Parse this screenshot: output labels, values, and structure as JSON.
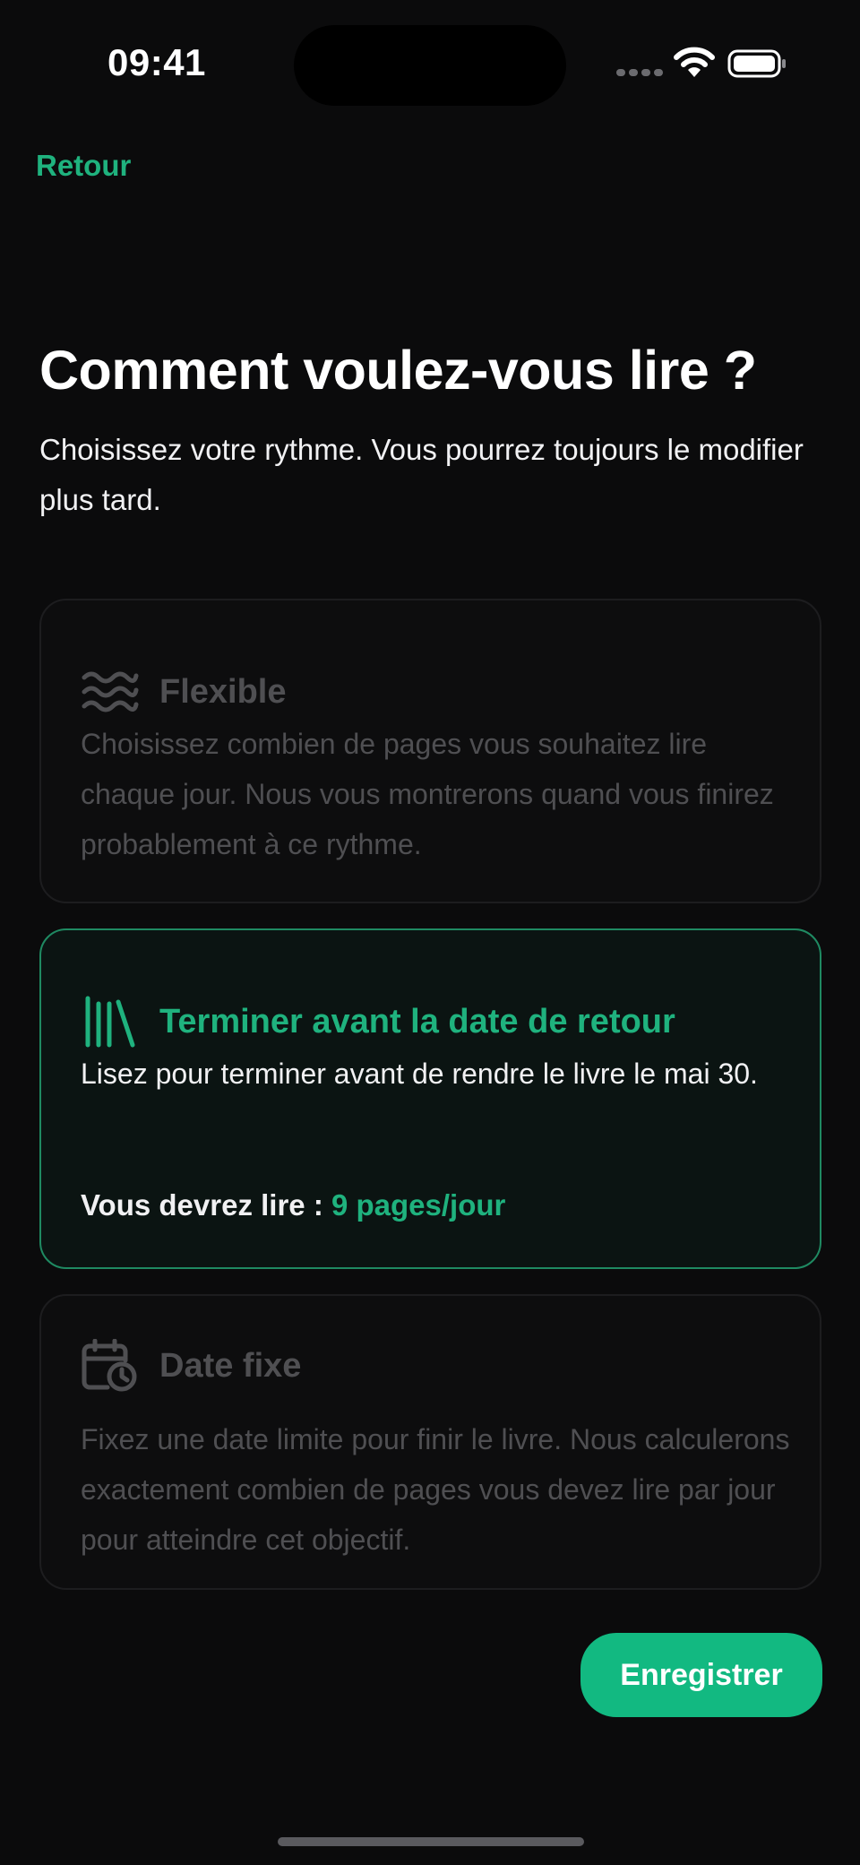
{
  "status_bar": {
    "time": "09:41",
    "icons": [
      "signal-dots-icon",
      "wifi-icon",
      "battery-icon"
    ]
  },
  "nav": {
    "back_label": "Retour"
  },
  "header": {
    "title": "Comment voulez-vous lire ?",
    "subtitle": "Choisissez votre rythme. Vous pourrez toujours le modifier plus tard."
  },
  "options": [
    {
      "icon": "waves-icon",
      "title": "Flexible",
      "description": "Choisissez combien de pages vous souhaitez lire chaque jour. Nous vous montrerons quand vous finirez probablement à ce rythme.",
      "selected": false
    },
    {
      "icon": "books-icon",
      "title": "Terminer avant la date de retour",
      "description": "Lisez pour terminer avant de rendre le livre le mai 30.",
      "need_label": "Vous devrez lire : ",
      "need_value": "9 pages/jour",
      "selected": true
    },
    {
      "icon": "calendar-clock-icon",
      "title": "Date fixe",
      "description": "Fixez une date limite pour finir le livre. Nous calculerons exactement combien de pages vous devez lire par jour pour atteindre cet objectif.",
      "selected": false
    }
  ],
  "actions": {
    "save_label": "Enregistrer"
  },
  "colors": {
    "accent": "#12b981",
    "accent_text": "#1fb27e",
    "background": "#0b0b0c",
    "muted_text": "#4f4f52"
  }
}
